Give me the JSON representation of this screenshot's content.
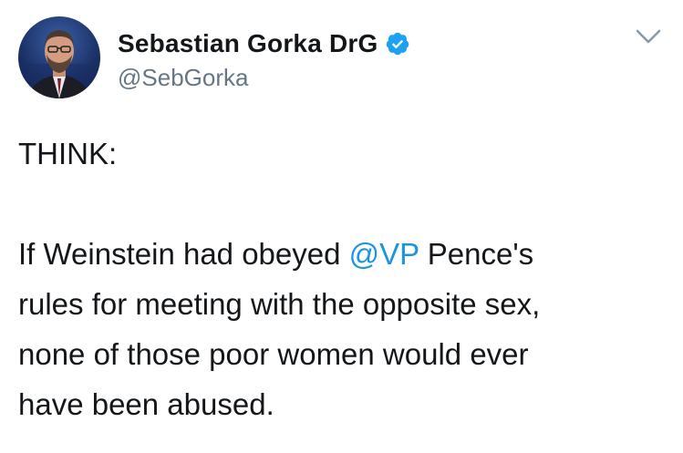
{
  "tweet": {
    "display_name": "Sebastian Gorka DrG",
    "handle": "@SebGorka",
    "verified": true,
    "text": {
      "line1": "THINK:",
      "line2_before": "If Weinstein had obeyed ",
      "mention": "@VP",
      "line2_after": " Pence's",
      "line3": "rules for meeting with the opposite sex,",
      "line4": "none of those poor women would ever",
      "line5": "have been abused."
    }
  },
  "icons": {
    "verified": "verified-badge-icon",
    "more": "chevron-down-icon"
  },
  "colors": {
    "text": "#14171a",
    "secondary": "#657786",
    "link": "#1b95e0",
    "verified": "#1da1f2"
  }
}
